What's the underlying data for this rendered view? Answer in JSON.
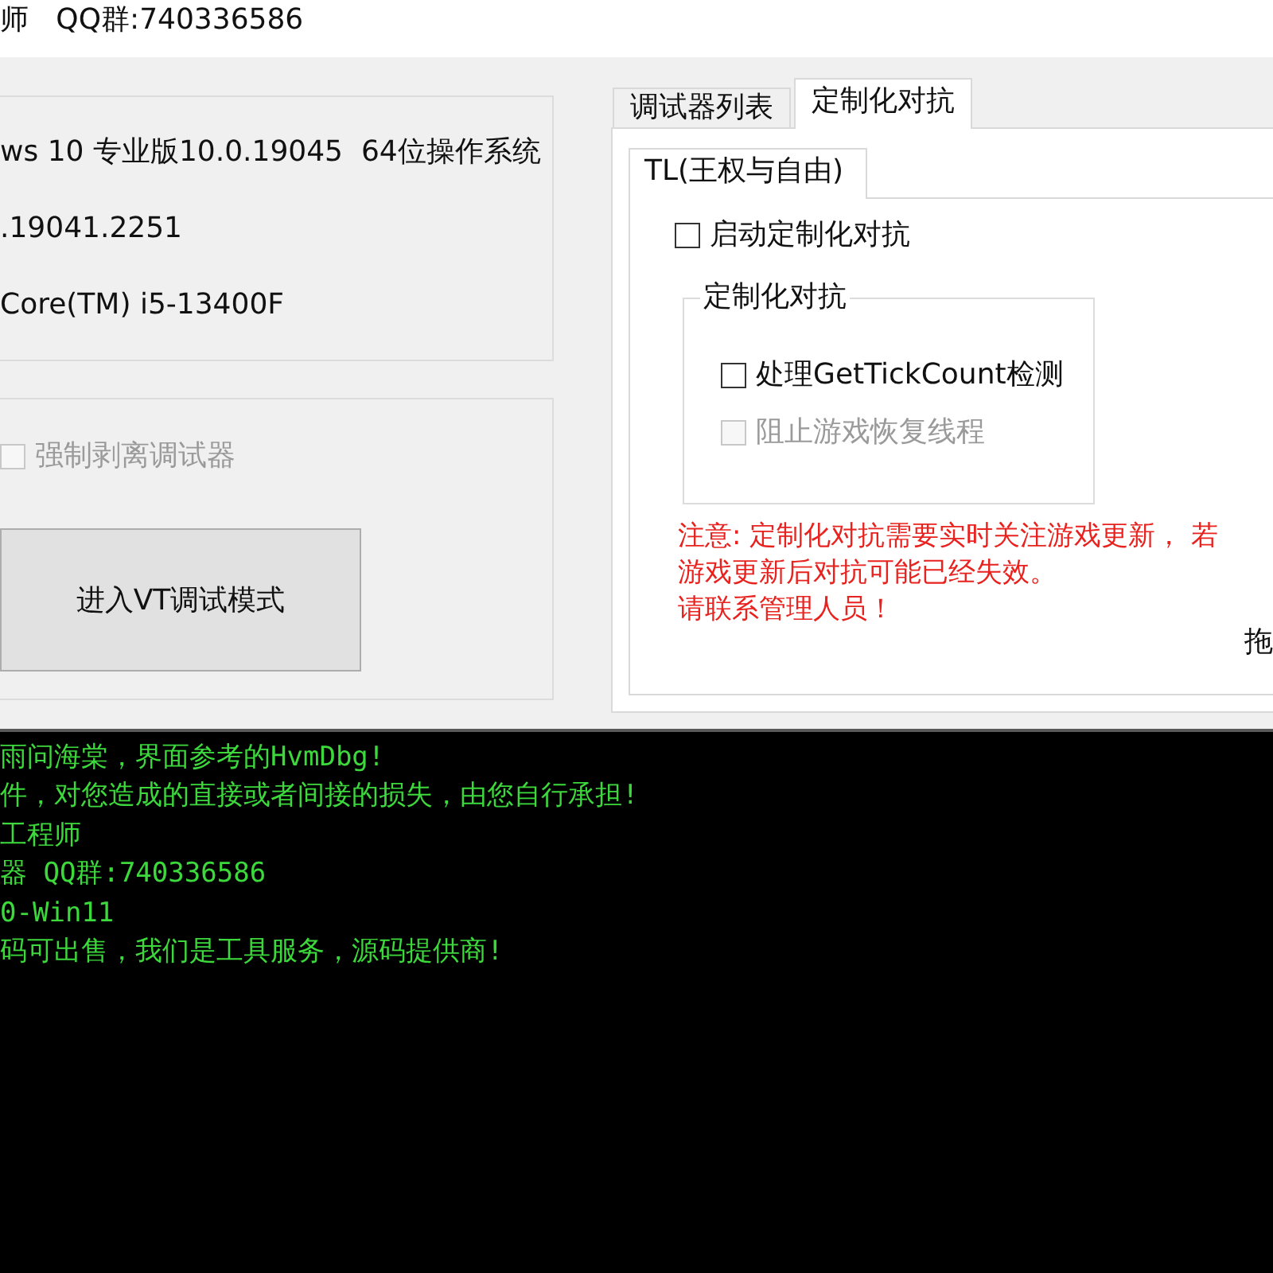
{
  "window": {
    "title": "师   QQ群:740336586"
  },
  "system_info": {
    "lines": [
      "ws 10 专业版10.0.19045  64位操作系统",
      ".19041.2251",
      "Core(TM) i5-13400F"
    ]
  },
  "debugger_panel": {
    "checkbox": {
      "label": "强制剥离调试器",
      "checked": false,
      "disabled": true
    },
    "button": "进入VT调试模式"
  },
  "tabs": [
    {
      "label": "调试器列表",
      "selected": false
    },
    {
      "label": "定制化对抗",
      "selected": true
    }
  ],
  "inner_tabs": [
    {
      "label": "TL(王权与自由)",
      "selected": true
    }
  ],
  "enable_checkbox": {
    "label": "启动定制化对抗",
    "checked": false,
    "disabled": false
  },
  "group": {
    "title": "定制化对抗",
    "checkboxes": [
      {
        "label": "处理GetTickCount检测",
        "checked": false,
        "disabled": false
      },
      {
        "label": "阻止游戏恢复线程",
        "checked": false,
        "disabled": true
      }
    ]
  },
  "notice": [
    "注意: 定制化对抗需要实时关注游戏更新， 若",
    "游戏更新后对抗可能已经失效。",
    "请联系管理人员！"
  ],
  "cut_label": "拖",
  "console": {
    "lines": [
      "雨问海棠，界面参考的HvmDbg!",
      "件，对您造成的直接或者间接的损失，由您自行承担!",
      "工程师",
      "器 QQ群:740336586",
      "0-Win11",
      "码可出售，我们是工具服务，源码提供商!"
    ]
  }
}
